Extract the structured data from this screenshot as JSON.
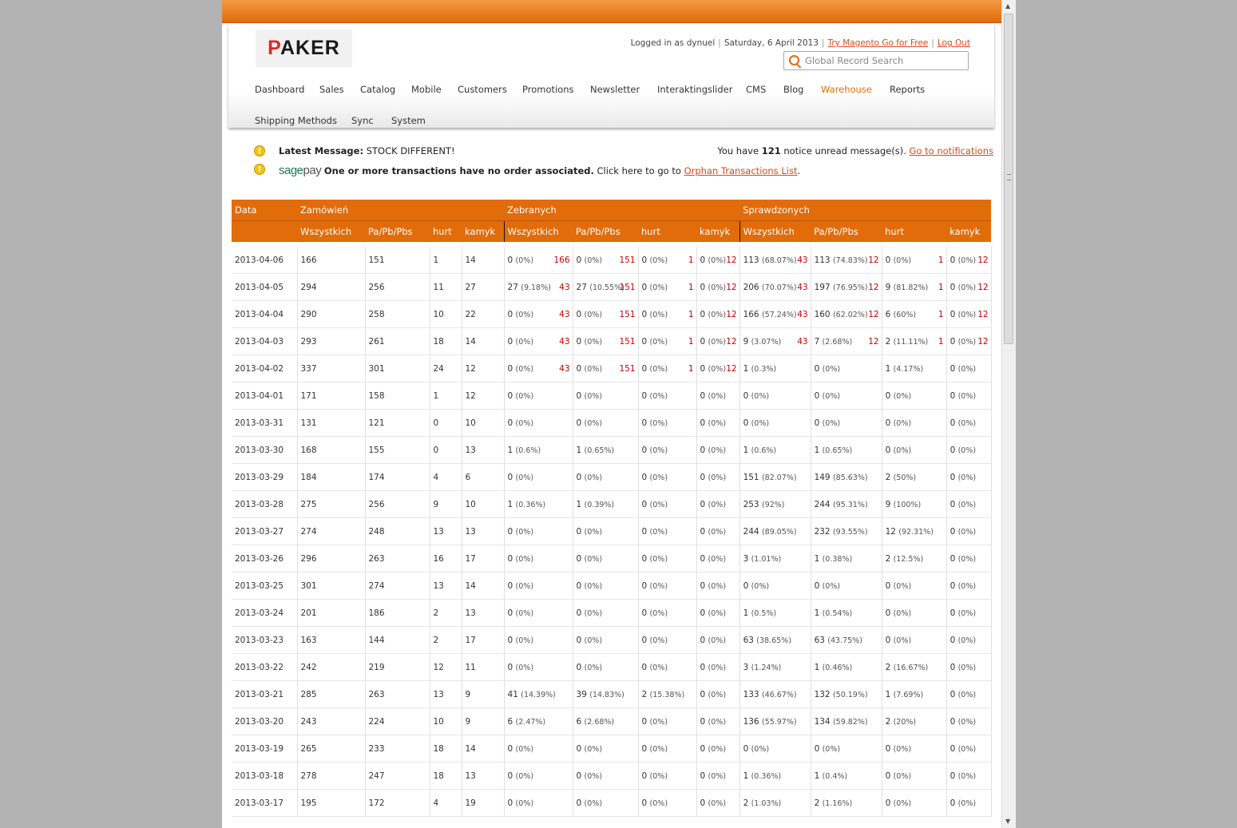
{
  "header": {
    "logo_text": "PAKER",
    "logged_in_as": "Logged in as dynuel",
    "date": "Saturday, 6 April 2013",
    "try_link": "Try Magento Go for Free",
    "logout_link": "Log Out",
    "search_placeholder": "Global Record Search"
  },
  "nav": {
    "items": [
      "Dashboard",
      "Sales",
      "Catalog",
      "Mobile",
      "Customers",
      "Promotions",
      "Newsletter",
      "Interaktingslider",
      "CMS",
      "Blog",
      "Warehouse",
      "Reports",
      "Shipping Methods",
      "Sync",
      "System"
    ],
    "active": "Warehouse"
  },
  "messages": {
    "latest_label": "Latest Message:",
    "latest_text": "STOCK DIFFERENT!",
    "unread_prefix": "You have",
    "unread_count": "121",
    "unread_suffix": "notice unread message(s).",
    "notifications_link": "Go to notifications",
    "sage_1": "sage",
    "sage_2": "pay",
    "sage_bold": "One or more transactions have no order associated.",
    "sage_text": "Click here to go to",
    "orphan_link": "Orphan Transactions List",
    "period": "."
  },
  "table": {
    "group_headers": [
      "Data",
      "Zamówień",
      "Zebranych",
      "Sprawdzonych"
    ],
    "sub_headers": [
      "Wszystkich",
      "Pa/Pb/Pbs",
      "hurt",
      "kamyk",
      "Wszystkich",
      "Pa/Pb/Pbs",
      "hurt",
      "kamyk",
      "Wszystkich",
      "Pa/Pb/Pbs",
      "hurt",
      "kamyk"
    ],
    "rows": [
      {
        "date": "2013-04-06",
        "orders": [
          "166",
          "151",
          "1",
          "14"
        ],
        "cells": [
          [
            "0",
            "(0%)",
            "166"
          ],
          [
            "0",
            "(0%)",
            "151"
          ],
          [
            "0",
            "(0%)",
            "1"
          ],
          [
            "0",
            "(0%)",
            "12"
          ],
          [
            "113",
            "(68.07%)",
            "43"
          ],
          [
            "113",
            "(74.83%)",
            "12"
          ],
          [
            "0",
            "(0%)",
            "1"
          ],
          [
            "0",
            "(0%)",
            "12"
          ]
        ]
      },
      {
        "date": "2013-04-05",
        "orders": [
          "294",
          "256",
          "11",
          "27"
        ],
        "cells": [
          [
            "27",
            "(9.18%)",
            "43"
          ],
          [
            "27",
            "(10.55%)",
            "151"
          ],
          [
            "0",
            "(0%)",
            "1"
          ],
          [
            "0",
            "(0%)",
            "12"
          ],
          [
            "206",
            "(70.07%)",
            "43"
          ],
          [
            "197",
            "(76.95%)",
            "12"
          ],
          [
            "9",
            "(81.82%)",
            "1"
          ],
          [
            "0",
            "(0%)",
            "12"
          ]
        ]
      },
      {
        "date": "2013-04-04",
        "orders": [
          "290",
          "258",
          "10",
          "22"
        ],
        "cells": [
          [
            "0",
            "(0%)",
            "43"
          ],
          [
            "0",
            "(0%)",
            "151"
          ],
          [
            "0",
            "(0%)",
            "1"
          ],
          [
            "0",
            "(0%)",
            "12"
          ],
          [
            "166",
            "(57.24%)",
            "43"
          ],
          [
            "160",
            "(62.02%)",
            "12"
          ],
          [
            "6",
            "(60%)",
            "1"
          ],
          [
            "0",
            "(0%)",
            "12"
          ]
        ]
      },
      {
        "date": "2013-04-03",
        "orders": [
          "293",
          "261",
          "18",
          "14"
        ],
        "cells": [
          [
            "0",
            "(0%)",
            "43"
          ],
          [
            "0",
            "(0%)",
            "151"
          ],
          [
            "0",
            "(0%)",
            "1"
          ],
          [
            "0",
            "(0%)",
            "12"
          ],
          [
            "9",
            "(3.07%)",
            "43"
          ],
          [
            "7",
            "(2.68%)",
            "12"
          ],
          [
            "2",
            "(11.11%)",
            "1"
          ],
          [
            "0",
            "(0%)",
            "12"
          ]
        ]
      },
      {
        "date": "2013-04-02",
        "orders": [
          "337",
          "301",
          "24",
          "12"
        ],
        "cells": [
          [
            "0",
            "(0%)",
            "43"
          ],
          [
            "0",
            "(0%)",
            "151"
          ],
          [
            "0",
            "(0%)",
            "1"
          ],
          [
            "0",
            "(0%)",
            "12"
          ],
          [
            "1",
            "(0.3%)",
            ""
          ],
          [
            "0",
            "(0%)",
            ""
          ],
          [
            "1",
            "(4.17%)",
            ""
          ],
          [
            "0",
            "(0%)",
            ""
          ]
        ]
      },
      {
        "date": "2013-04-01",
        "orders": [
          "171",
          "158",
          "1",
          "12"
        ],
        "cells": [
          [
            "0",
            "(0%)",
            ""
          ],
          [
            "0",
            "(0%)",
            ""
          ],
          [
            "0",
            "(0%)",
            ""
          ],
          [
            "0",
            "(0%)",
            ""
          ],
          [
            "0",
            "(0%)",
            ""
          ],
          [
            "0",
            "(0%)",
            ""
          ],
          [
            "0",
            "(0%)",
            ""
          ],
          [
            "0",
            "(0%)",
            ""
          ]
        ]
      },
      {
        "date": "2013-03-31",
        "orders": [
          "131",
          "121",
          "0",
          "10"
        ],
        "cells": [
          [
            "0",
            "(0%)",
            ""
          ],
          [
            "0",
            "(0%)",
            ""
          ],
          [
            "0",
            "(0%)",
            ""
          ],
          [
            "0",
            "(0%)",
            ""
          ],
          [
            "0",
            "(0%)",
            ""
          ],
          [
            "0",
            "(0%)",
            ""
          ],
          [
            "0",
            "(0%)",
            ""
          ],
          [
            "0",
            "(0%)",
            ""
          ]
        ]
      },
      {
        "date": "2013-03-30",
        "orders": [
          "168",
          "155",
          "0",
          "13"
        ],
        "cells": [
          [
            "1",
            "(0.6%)",
            ""
          ],
          [
            "1",
            "(0.65%)",
            ""
          ],
          [
            "0",
            "(0%)",
            ""
          ],
          [
            "0",
            "(0%)",
            ""
          ],
          [
            "1",
            "(0.6%)",
            ""
          ],
          [
            "1",
            "(0.65%)",
            ""
          ],
          [
            "0",
            "(0%)",
            ""
          ],
          [
            "0",
            "(0%)",
            ""
          ]
        ]
      },
      {
        "date": "2013-03-29",
        "orders": [
          "184",
          "174",
          "4",
          "6"
        ],
        "cells": [
          [
            "0",
            "(0%)",
            ""
          ],
          [
            "0",
            "(0%)",
            ""
          ],
          [
            "0",
            "(0%)",
            ""
          ],
          [
            "0",
            "(0%)",
            ""
          ],
          [
            "151",
            "(82.07%)",
            ""
          ],
          [
            "149",
            "(85.63%)",
            ""
          ],
          [
            "2",
            "(50%)",
            ""
          ],
          [
            "0",
            "(0%)",
            ""
          ]
        ]
      },
      {
        "date": "2013-03-28",
        "orders": [
          "275",
          "256",
          "9",
          "10"
        ],
        "cells": [
          [
            "1",
            "(0.36%)",
            ""
          ],
          [
            "1",
            "(0.39%)",
            ""
          ],
          [
            "0",
            "(0%)",
            ""
          ],
          [
            "0",
            "(0%)",
            ""
          ],
          [
            "253",
            "(92%)",
            ""
          ],
          [
            "244",
            "(95.31%)",
            ""
          ],
          [
            "9",
            "(100%)",
            ""
          ],
          [
            "0",
            "(0%)",
            ""
          ]
        ]
      },
      {
        "date": "2013-03-27",
        "orders": [
          "274",
          "248",
          "13",
          "13"
        ],
        "cells": [
          [
            "0",
            "(0%)",
            ""
          ],
          [
            "0",
            "(0%)",
            ""
          ],
          [
            "0",
            "(0%)",
            ""
          ],
          [
            "0",
            "(0%)",
            ""
          ],
          [
            "244",
            "(89.05%)",
            ""
          ],
          [
            "232",
            "(93.55%)",
            ""
          ],
          [
            "12",
            "(92.31%)",
            ""
          ],
          [
            "0",
            "(0%)",
            ""
          ]
        ]
      },
      {
        "date": "2013-03-26",
        "orders": [
          "296",
          "263",
          "16",
          "17"
        ],
        "cells": [
          [
            "0",
            "(0%)",
            ""
          ],
          [
            "0",
            "(0%)",
            ""
          ],
          [
            "0",
            "(0%)",
            ""
          ],
          [
            "0",
            "(0%)",
            ""
          ],
          [
            "3",
            "(1.01%)",
            ""
          ],
          [
            "1",
            "(0.38%)",
            ""
          ],
          [
            "2",
            "(12.5%)",
            ""
          ],
          [
            "0",
            "(0%)",
            ""
          ]
        ]
      },
      {
        "date": "2013-03-25",
        "orders": [
          "301",
          "274",
          "13",
          "14"
        ],
        "cells": [
          [
            "0",
            "(0%)",
            ""
          ],
          [
            "0",
            "(0%)",
            ""
          ],
          [
            "0",
            "(0%)",
            ""
          ],
          [
            "0",
            "(0%)",
            ""
          ],
          [
            "0",
            "(0%)",
            ""
          ],
          [
            "0",
            "(0%)",
            ""
          ],
          [
            "0",
            "(0%)",
            ""
          ],
          [
            "0",
            "(0%)",
            ""
          ]
        ]
      },
      {
        "date": "2013-03-24",
        "orders": [
          "201",
          "186",
          "2",
          "13"
        ],
        "cells": [
          [
            "0",
            "(0%)",
            ""
          ],
          [
            "0",
            "(0%)",
            ""
          ],
          [
            "0",
            "(0%)",
            ""
          ],
          [
            "0",
            "(0%)",
            ""
          ],
          [
            "1",
            "(0.5%)",
            ""
          ],
          [
            "1",
            "(0.54%)",
            ""
          ],
          [
            "0",
            "(0%)",
            ""
          ],
          [
            "0",
            "(0%)",
            ""
          ]
        ]
      },
      {
        "date": "2013-03-23",
        "orders": [
          "163",
          "144",
          "2",
          "17"
        ],
        "cells": [
          [
            "0",
            "(0%)",
            ""
          ],
          [
            "0",
            "(0%)",
            ""
          ],
          [
            "0",
            "(0%)",
            ""
          ],
          [
            "0",
            "(0%)",
            ""
          ],
          [
            "63",
            "(38.65%)",
            ""
          ],
          [
            "63",
            "(43.75%)",
            ""
          ],
          [
            "0",
            "(0%)",
            ""
          ],
          [
            "0",
            "(0%)",
            ""
          ]
        ]
      },
      {
        "date": "2013-03-22",
        "orders": [
          "242",
          "219",
          "12",
          "11"
        ],
        "cells": [
          [
            "0",
            "(0%)",
            ""
          ],
          [
            "0",
            "(0%)",
            ""
          ],
          [
            "0",
            "(0%)",
            ""
          ],
          [
            "0",
            "(0%)",
            ""
          ],
          [
            "3",
            "(1.24%)",
            ""
          ],
          [
            "1",
            "(0.46%)",
            ""
          ],
          [
            "2",
            "(16.67%)",
            ""
          ],
          [
            "0",
            "(0%)",
            ""
          ]
        ]
      },
      {
        "date": "2013-03-21",
        "orders": [
          "285",
          "263",
          "13",
          "9"
        ],
        "cells": [
          [
            "41",
            "(14.39%)",
            ""
          ],
          [
            "39",
            "(14.83%)",
            ""
          ],
          [
            "2",
            "(15.38%)",
            ""
          ],
          [
            "0",
            "(0%)",
            ""
          ],
          [
            "133",
            "(46.67%)",
            ""
          ],
          [
            "132",
            "(50.19%)",
            ""
          ],
          [
            "1",
            "(7.69%)",
            ""
          ],
          [
            "0",
            "(0%)",
            ""
          ]
        ]
      },
      {
        "date": "2013-03-20",
        "orders": [
          "243",
          "224",
          "10",
          "9"
        ],
        "cells": [
          [
            "6",
            "(2.47%)",
            ""
          ],
          [
            "6",
            "(2.68%)",
            ""
          ],
          [
            "0",
            "(0%)",
            ""
          ],
          [
            "0",
            "(0%)",
            ""
          ],
          [
            "136",
            "(55.97%)",
            ""
          ],
          [
            "134",
            "(59.82%)",
            ""
          ],
          [
            "2",
            "(20%)",
            ""
          ],
          [
            "0",
            "(0%)",
            ""
          ]
        ]
      },
      {
        "date": "2013-03-19",
        "orders": [
          "265",
          "233",
          "18",
          "14"
        ],
        "cells": [
          [
            "0",
            "(0%)",
            ""
          ],
          [
            "0",
            "(0%)",
            ""
          ],
          [
            "0",
            "(0%)",
            ""
          ],
          [
            "0",
            "(0%)",
            ""
          ],
          [
            "0",
            "(0%)",
            ""
          ],
          [
            "0",
            "(0%)",
            ""
          ],
          [
            "0",
            "(0%)",
            ""
          ],
          [
            "0",
            "(0%)",
            ""
          ]
        ]
      },
      {
        "date": "2013-03-18",
        "orders": [
          "278",
          "247",
          "18",
          "13"
        ],
        "cells": [
          [
            "0",
            "(0%)",
            ""
          ],
          [
            "0",
            "(0%)",
            ""
          ],
          [
            "0",
            "(0%)",
            ""
          ],
          [
            "0",
            "(0%)",
            ""
          ],
          [
            "1",
            "(0.36%)",
            ""
          ],
          [
            "1",
            "(0.4%)",
            ""
          ],
          [
            "0",
            "(0%)",
            ""
          ],
          [
            "0",
            "(0%)",
            ""
          ]
        ]
      },
      {
        "date": "2013-03-17",
        "orders": [
          "195",
          "172",
          "4",
          "19"
        ],
        "cells": [
          [
            "0",
            "(0%)",
            ""
          ],
          [
            "0",
            "(0%)",
            ""
          ],
          [
            "0",
            "(0%)",
            ""
          ],
          [
            "0",
            "(0%)",
            ""
          ],
          [
            "2",
            "(1.03%)",
            ""
          ],
          [
            "2",
            "(1.16%)",
            ""
          ],
          [
            "0",
            "(0%)",
            ""
          ],
          [
            "0",
            "(0%)",
            ""
          ]
        ]
      }
    ]
  },
  "colors": {
    "accent": "#e26b0a",
    "link": "#d54a1b",
    "red_count": "#cc0000"
  }
}
